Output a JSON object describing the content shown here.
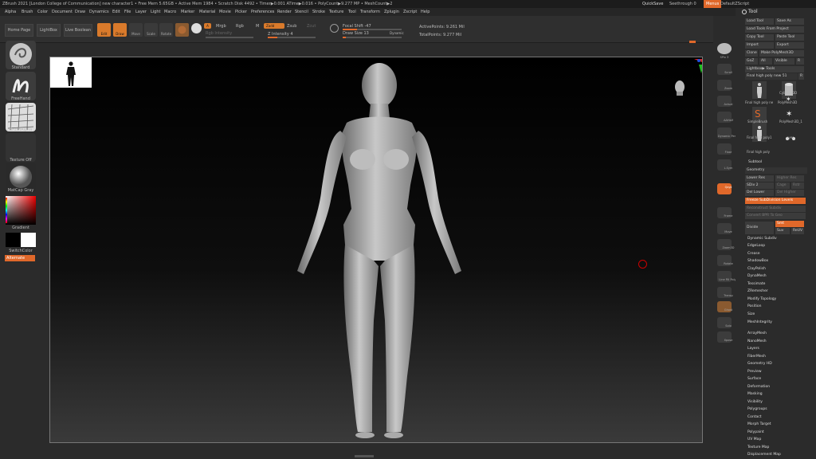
{
  "titlebar": {
    "title": "ZBrush 2021 [London College of Communication]   new character1   • Free Mem 5.65GB • Active Mem 1984 • Scratch Disk 4492 • Timer▶0.001 ATime▶0.016 • PolyCount▶9.277 MP • MeshCount▶2",
    "quicksave": "QuickSave",
    "seethrough": "Seethrough  0",
    "menus": "Menus",
    "default_script": "DefaultZScript"
  },
  "menubar": {
    "items": [
      "Alpha",
      "Brush",
      "Color",
      "Document",
      "Draw",
      "Dynamics",
      "Edit",
      "File",
      "Layer",
      "Light",
      "Macro",
      "Marker",
      "Material",
      "Movie",
      "Picker",
      "Preferences",
      "Render",
      "Stencil",
      "Stroke",
      "Texture",
      "Tool",
      "Transform",
      "Zplugin",
      "Zscript",
      "Help"
    ]
  },
  "shelf": {
    "home_page": "Home Page",
    "lightbox": "LightBox",
    "live_boolean": "Live Boolean",
    "edit": "Edit",
    "draw": "Draw",
    "move": "Move",
    "scale": "Scale",
    "rotate": "Rotate",
    "a_label": "A",
    "mrgb": "Mrgb",
    "rgb": "Rgb",
    "m": "M",
    "zadd": "Zadd",
    "zsub": "Zsub",
    "zcut": "Zcut",
    "rgb_intensity": "Rgb Intensity",
    "z_intensity": "Z Intensity 4",
    "focal_shift": "Focal Shift -47",
    "draw_size": "Draw Size 13",
    "dynamic": "Dynamic",
    "active_points": "ActivePoints: 9.261 Mil",
    "total_points": "TotalPoints: 9.277 Mil"
  },
  "left": {
    "standard": "Standard",
    "freehand": "FreeHand",
    "brush_alpha": "BrushAlpha",
    "texture_off": "Texture Off",
    "matcap_gray": "MatCap Gray",
    "gradient": "Gradient",
    "switch_color": "SwitchColor",
    "alternate": "Alternate"
  },
  "right_shelf": [
    "SPix 3",
    "Scroll",
    "Zoom",
    "Actual",
    "AAHalf",
    "Dynamic Persp",
    "Floor",
    "L.Sym",
    "Qxyz",
    "Frame",
    "Move",
    "Zoom3D",
    "Rotate",
    "Line Fill PolyF",
    "Transp",
    "Ghost",
    "Solo",
    "Xpose"
  ],
  "tray": {
    "tool_title": "Tool",
    "load_tool": "Load Tool",
    "save_as": "Save As",
    "load_from_project": "Load Tools From Project",
    "copy_tool": "Copy Tool",
    "paste_tool": "Paste Tool",
    "import": "Import",
    "export": "Export",
    "clone": "Clone",
    "make_polymesh": "Make PolyMesh3D",
    "goz": "GoZ",
    "all": "All",
    "visible": "Visible",
    "r": "R",
    "lightbox_tools": "Lightbox▶ Tools",
    "final_high": "Final high poly new  51",
    "sub_r": "R",
    "thumbs": [
      "Final high poly ne",
      "Cylinder3D",
      "PolyMesh3D",
      "SimpleBrush",
      "PolyMesh3D_1",
      "Final high poly1",
      "eyes",
      "Final high poly"
    ],
    "subtool": "Subtool",
    "geometry": "Geometry",
    "lower_res": "Lower Res",
    "higher_res": "Higher Res",
    "sdiv": "SDiv 2",
    "cage": "Cage",
    "rstr": "Rstr",
    "del_lower": "Del Lower",
    "del_higher": "Del Higher",
    "freeze": "Freeze SubDivision Levels",
    "reconstruct": "Reconstruct Subdiv",
    "convert_bpr": "Convert BPR To Geo",
    "divide": "Divide",
    "smt": "Smt",
    "suv": "Suv",
    "reuv": "ReUV",
    "geo_items": [
      "Dynamic Subdiv",
      "EdgeLoop",
      "Crease",
      "ShadowBox",
      "ClayPolish",
      "DynaMesh",
      "Tessimate",
      "ZRemesher",
      "Modify Topology",
      "Position",
      "Size",
      "MeshIntegrity"
    ],
    "tool_items": [
      "ArrayMesh",
      "NanoMesh",
      "Layers",
      "FiberMesh",
      "Geometry HD",
      "Preview",
      "Surface",
      "Deformation",
      "Masking",
      "Visibility",
      "Polygroups",
      "Contact",
      "Morph Target",
      "Polypaint",
      "UV Map",
      "Texture Map",
      "Displacement Map"
    ]
  },
  "colors": {
    "accent": "#e0682a",
    "panel": "#2b2b2b",
    "viewport": "#000000"
  }
}
